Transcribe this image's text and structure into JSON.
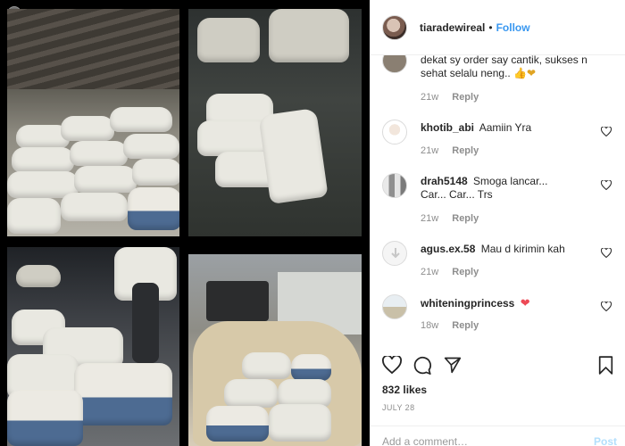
{
  "post": {
    "username": "tiaradewireal",
    "follow_label": "Follow",
    "separator": "•",
    "likes": "832 likes",
    "date": "JULY 28",
    "add_comment_placeholder": "Add a comment…",
    "post_label": "Post"
  },
  "comments": [
    {
      "username": "",
      "text": "dekat sy order say cantik, sukses n sehat selalu neng..",
      "emoji": "👍❤",
      "time": "21w",
      "reply": "Reply",
      "avatar": "partial-avatar"
    },
    {
      "username": "khotib_abi",
      "text": "Aamiin Yra",
      "time": "21w",
      "reply": "Reply",
      "avatar": "man-avatar"
    },
    {
      "username": "drah5148",
      "text": "Smoga lancar... Car... Car... Trs",
      "time": "21w",
      "reply": "Reply",
      "avatar": "group-avatar"
    },
    {
      "username": "agus.ex.58",
      "text": "Mau d kirimin kah",
      "time": "21w",
      "reply": "Reply",
      "avatar": "default-avatar"
    },
    {
      "username": "whiteningprincess",
      "text": "",
      "emoji": "❤",
      "time": "18w",
      "reply": "Reply",
      "avatar": "landscape-avatar"
    }
  ],
  "colors": {
    "link_blue": "#3897f0",
    "heart_red": "#ed4956",
    "muted_text": "#8e8e8e",
    "post_disabled": "#b2dffc"
  },
  "icons": [
    "heart-icon",
    "comment-icon",
    "share-icon",
    "bookmark-icon",
    "download-icon"
  ]
}
